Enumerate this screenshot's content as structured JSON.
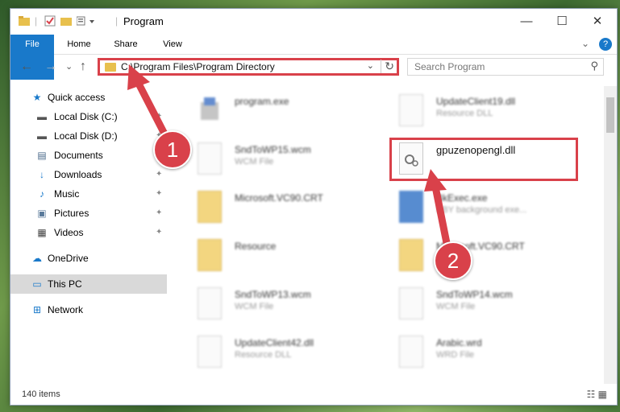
{
  "window": {
    "title": "Program",
    "controls": {
      "minimize": "—",
      "maximize": "☐",
      "close": "✕"
    }
  },
  "ribbon": {
    "tabs": [
      "File",
      "Home",
      "Share",
      "View"
    ],
    "expand": "⌄",
    "help": "?"
  },
  "nav": {
    "back": "←",
    "forward": "→",
    "recent": "⌄",
    "up": "↑",
    "address": "C:\\Program Files\\Program Directory",
    "search_placeholder": "Search Program"
  },
  "sidebar": {
    "items": [
      {
        "label": "Quick access",
        "icon": "star-icon",
        "glyph": "★"
      },
      {
        "label": "Local Disk (C:)",
        "icon": "drive-icon",
        "glyph": "▬"
      },
      {
        "label": "Local Disk (D:)",
        "icon": "drive-icon",
        "glyph": "▬"
      },
      {
        "label": "Documents",
        "icon": "documents-icon",
        "glyph": "▤"
      },
      {
        "label": "Downloads",
        "icon": "download-icon",
        "glyph": "↓"
      },
      {
        "label": "Music",
        "icon": "music-icon",
        "glyph": "♪"
      },
      {
        "label": "Pictures",
        "icon": "pictures-icon",
        "glyph": "▣"
      },
      {
        "label": "Videos",
        "icon": "videos-icon",
        "glyph": "▦"
      },
      {
        "label": "OneDrive",
        "icon": "cloud-icon",
        "glyph": "☁"
      },
      {
        "label": "This PC",
        "icon": "computer-icon",
        "glyph": "▭"
      },
      {
        "label": "Network",
        "icon": "network-icon",
        "glyph": "⊞"
      }
    ],
    "pin": "📌"
  },
  "files": [
    {
      "name": "program.exe",
      "type": ""
    },
    {
      "name": "UpdateClient19.dll",
      "type": "Resource DLL"
    },
    {
      "name": "SndToWP15.wcm",
      "type": "WCM File"
    },
    {
      "name": "gpuzenopengl.dll",
      "type": ""
    },
    {
      "name": "Microsoft.VC90.CRT",
      "type": ""
    },
    {
      "name": "BkExec.exe",
      "type": "BBY background exe..."
    },
    {
      "name": "Resource",
      "type": ""
    },
    {
      "name": "Microsoft.VC90.CRT",
      "type": ""
    },
    {
      "name": "SndToWP13.wcm",
      "type": "WCM File"
    },
    {
      "name": "SndToWP14.wcm",
      "type": "WCM File"
    },
    {
      "name": "UpdateClient42.dll",
      "type": "Resource DLL"
    },
    {
      "name": "Arabic.wrd",
      "type": "WRD File"
    }
  ],
  "status": {
    "count": "140 items"
  },
  "annotations": {
    "step1": "1",
    "step2": "2"
  },
  "colors": {
    "accent": "#1979ca",
    "highlight": "#d9414a"
  }
}
